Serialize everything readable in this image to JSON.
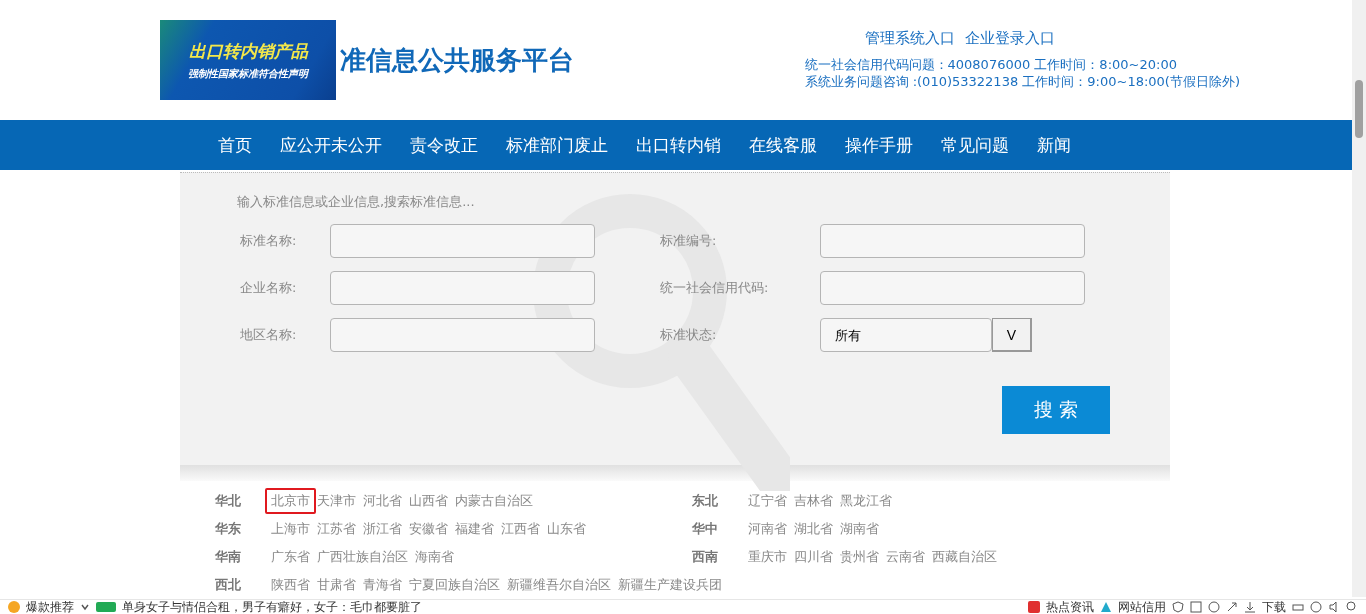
{
  "logo": {
    "line_1": "出口转内销产品",
    "line_2": "强制性国家标准符合性声明"
  },
  "site_title": "准信息公共服务平台",
  "header_links": [
    "管理系统入口",
    "企业登录入口"
  ],
  "contact_lines": [
    "统一社会信用代码问题：4008076000 工作时间：8:00~20:00",
    "系统业务问题咨询 :(010)53322138 工作时间：9:00~18:00(节假日除外)"
  ],
  "nav": [
    "首页",
    "应公开未公开",
    "责令改正",
    "标准部门废止",
    "出口转内销",
    "在线客服",
    "操作手册",
    "常见问题",
    "新闻"
  ],
  "search": {
    "hint": "输入标准信息或企业信息,搜索标准信息...",
    "fields": [
      {
        "label": "标准名称:",
        "kind": "text"
      },
      {
        "label": "标准编号:",
        "kind": "text"
      },
      {
        "label": "企业名称:",
        "kind": "text"
      },
      {
        "label": "统一社会信用代码:",
        "kind": "text"
      },
      {
        "label": "地区名称:",
        "kind": "text"
      },
      {
        "label": "标准状态:",
        "kind": "select",
        "value": "所有",
        "toggle": "V"
      }
    ],
    "button": "搜 索"
  },
  "regions": [
    {
      "name": "华北",
      "cities": [
        {
          "name": "北京市",
          "selected": true
        },
        {
          "name": "天津市",
          "selected": false
        },
        {
          "name": "河北省",
          "selected": false
        },
        {
          "name": "山西省",
          "selected": false
        },
        {
          "name": "内蒙古自治区",
          "selected": false
        }
      ]
    },
    {
      "name": "东北",
      "cities": [
        {
          "name": "辽宁省",
          "selected": false
        },
        {
          "name": "吉林省",
          "selected": false
        },
        {
          "name": "黑龙江省",
          "selected": false
        }
      ]
    },
    {
      "name": "华东",
      "cities": [
        {
          "name": "上海市",
          "selected": false
        },
        {
          "name": "江苏省",
          "selected": false
        },
        {
          "name": "浙江省",
          "selected": false
        },
        {
          "name": "安徽省",
          "selected": false
        },
        {
          "name": "福建省",
          "selected": false
        },
        {
          "name": "江西省",
          "selected": false
        },
        {
          "name": "山东省",
          "selected": false
        }
      ]
    },
    {
      "name": "华中",
      "cities": [
        {
          "name": "河南省",
          "selected": false
        },
        {
          "name": "湖北省",
          "selected": false
        },
        {
          "name": "湖南省",
          "selected": false
        }
      ]
    },
    {
      "name": "华南",
      "cities": [
        {
          "name": "广东省",
          "selected": false
        },
        {
          "name": "广西壮族自治区",
          "selected": false
        },
        {
          "name": "海南省",
          "selected": false
        }
      ]
    },
    {
      "name": "西南",
      "cities": [
        {
          "name": "重庆市",
          "selected": false
        },
        {
          "name": "四川省",
          "selected": false
        },
        {
          "name": "贵州省",
          "selected": false
        },
        {
          "name": "云南省",
          "selected": false
        },
        {
          "name": "西藏自治区",
          "selected": false
        }
      ]
    },
    {
      "name": "西北",
      "cities": [
        {
          "name": "陕西省",
          "selected": false
        },
        {
          "name": "甘肃省",
          "selected": false
        },
        {
          "name": "青海省",
          "selected": false
        },
        {
          "name": "宁夏回族自治区",
          "selected": false
        },
        {
          "name": "新疆维吾尔自治区",
          "selected": false
        },
        {
          "name": "新疆生产建设兵团",
          "selected": false
        }
      ]
    }
  ],
  "browser_bar": {
    "left": [
      "爆款推荐",
      "单身女子与情侣合租，男子有癖好，女子：毛巾都要脏了"
    ],
    "right": [
      "热点资讯",
      "网站信用",
      "下载"
    ]
  }
}
